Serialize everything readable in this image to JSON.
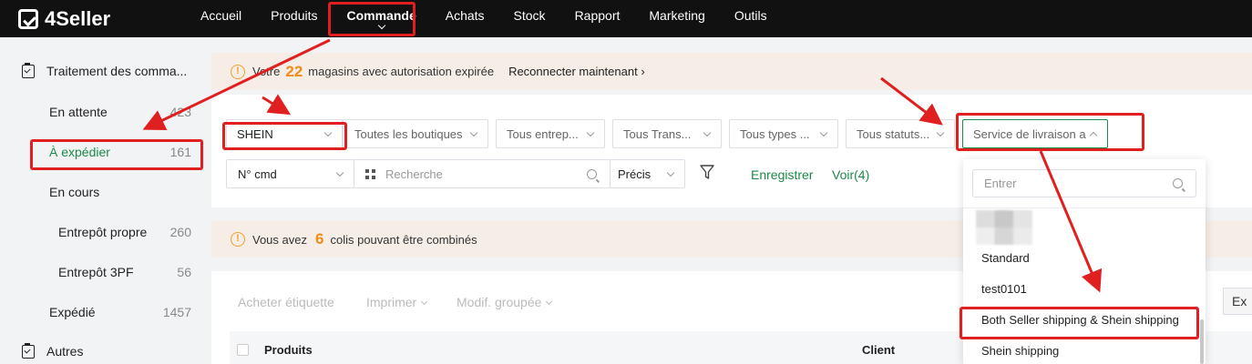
{
  "app": {
    "brand": "4Seller"
  },
  "nav": {
    "items": [
      {
        "label": "Accueil"
      },
      {
        "label": "Produits"
      },
      {
        "label": "Commande",
        "active": true
      },
      {
        "label": "Achats"
      },
      {
        "label": "Stock"
      },
      {
        "label": "Rapport"
      },
      {
        "label": "Marketing"
      },
      {
        "label": "Outils"
      }
    ]
  },
  "sidebar": {
    "group1": "Traitement des comma...",
    "items": [
      {
        "label": "En attente",
        "count": "423"
      },
      {
        "label": "À expédier",
        "count": "161",
        "active": true
      },
      {
        "label": "En cours",
        "count": ""
      },
      {
        "label": "Entrepôt propre",
        "count": "260"
      },
      {
        "label": "Entrepôt 3PF",
        "count": "56"
      },
      {
        "label": "Expédié",
        "count": "1457"
      }
    ],
    "group2": "Autres"
  },
  "banner1": {
    "prefix": "Votre",
    "number": "22",
    "suffix": "magasins avec autorisation expirée",
    "link": "Reconnecter maintenant ›"
  },
  "filters": {
    "platform": "SHEIN",
    "shops": "Toutes les boutiques",
    "warehouse": "Tous entrep...",
    "transport": "Tous Trans...",
    "types": "Tous types ...",
    "statuses": "Tous statuts...",
    "delivery_service": "Service de livraison a",
    "order_field": "N° cmd",
    "search_placeholder": "Recherche",
    "match_mode": "Précis",
    "save_label": "Enregistrer",
    "view_label": "Voir(4)"
  },
  "banner2": {
    "prefix": "Vous avez",
    "number": "6",
    "suffix": "colis pouvant être combinés"
  },
  "toolbar": {
    "buy_label": "Acheter étiquette",
    "print_label": "Imprimer",
    "bulk_label": "Modif. groupée",
    "export_label": "Ex"
  },
  "table": {
    "headers": {
      "products": "Produits",
      "client": "Client"
    }
  },
  "dropdown": {
    "search_placeholder": "Entrer",
    "options": [
      "Standard",
      "test0101",
      "Both Seller shipping & Shein shipping",
      "Shein shipping"
    ]
  },
  "colors": {
    "accent": "#1c8a4a",
    "annotation": "#e02020",
    "warning": "#f08c1a"
  }
}
